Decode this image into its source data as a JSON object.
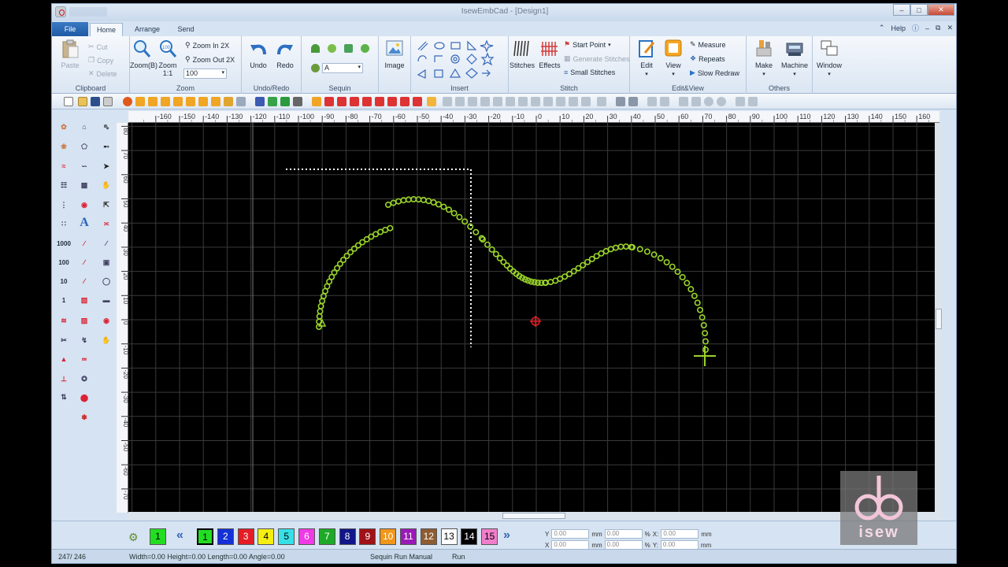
{
  "window": {
    "title": "IsewEmbCad - [Design1]"
  },
  "tabs": {
    "file": "File",
    "home": "Home",
    "arrange": "Arrange",
    "send": "Send"
  },
  "help": {
    "label": "Help"
  },
  "ribbon": {
    "clipboard": {
      "label": "Clipboard",
      "paste": "Paste",
      "cut": "Cut",
      "copy": "Copy",
      "delete": "Delete"
    },
    "zoom": {
      "label": "Zoom",
      "zoomb": "Zoom(B)",
      "zoom11": "Zoom 1:1",
      "zoom_in": "Zoom In 2X",
      "zoom_out": "Zoom Out 2X",
      "level": "100"
    },
    "undoredo": {
      "label": "Undo/Redo",
      "undo": "Undo",
      "redo": "Redo"
    },
    "sequin": {
      "label": "Sequin",
      "value": "A"
    },
    "image": {
      "label": "Image"
    },
    "insert": {
      "label": "Insert"
    },
    "stitch": {
      "label": "Stitch",
      "stitches": "Stitches",
      "effects": "Effects",
      "start_point": "Start Point",
      "generate": "Generate Stitches",
      "small": "Small Stitches"
    },
    "editview": {
      "label": "Edit&View",
      "edit": "Edit",
      "view": "View",
      "measure": "Measure",
      "repeats": "Repeats",
      "slow_redraw": "Slow Redraw"
    },
    "others": {
      "label": "Others",
      "make": "Make",
      "machine": "Machine",
      "window": "Window"
    }
  },
  "rulers": {
    "top": [
      "-160",
      "-150",
      "-140",
      "-130",
      "-120",
      "-110",
      "-100",
      "-90",
      "-80",
      "-70",
      "-60",
      "-50",
      "-40",
      "-30",
      "-20",
      "-10",
      "0",
      "10",
      "20",
      "30",
      "40",
      "50",
      "60",
      "70",
      "80",
      "90",
      "100",
      "110",
      "120",
      "130",
      "140",
      "150",
      "160"
    ],
    "left": [
      "80",
      "70",
      "60",
      "50",
      "40",
      "30",
      "20",
      "10",
      "0",
      "-10",
      "-20",
      "-30",
      "-40",
      "-50",
      "-60",
      "-70",
      "-80"
    ]
  },
  "left_tool_labels": {
    "num1000": "1000",
    "num100": "100",
    "num10": "10",
    "num1": "1",
    "text_tool": "A"
  },
  "colors": {
    "stitch": "#9ad42a",
    "swatches": [
      {
        "n": "1",
        "c": "#22dd22"
      },
      {
        "n": "2",
        "c": "#1430d6"
      },
      {
        "n": "3",
        "c": "#e51c24"
      },
      {
        "n": "4",
        "c": "#f4ee12"
      },
      {
        "n": "5",
        "c": "#36e0e6"
      },
      {
        "n": "6",
        "c": "#ef3ae6"
      },
      {
        "n": "7",
        "c": "#1eaa28"
      },
      {
        "n": "8",
        "c": "#12168a"
      },
      {
        "n": "9",
        "c": "#a01218"
      },
      {
        "n": "10",
        "c": "#f0961a"
      },
      {
        "n": "11",
        "c": "#9a1ab8"
      },
      {
        "n": "12",
        "c": "#8e5c32"
      },
      {
        "n": "13",
        "c": "#ffffff"
      },
      {
        "n": "14",
        "c": "#000000"
      },
      {
        "n": "15",
        "c": "#f27ecb"
      }
    ]
  },
  "palette": {
    "first": "1",
    "current": "1"
  },
  "coords": {
    "x_label": "X:",
    "y_label": "Y:",
    "x": "0.00",
    "y": "0.00",
    "w": "0.00",
    "h": "0.00",
    "pct1": "%",
    "pct2": "%",
    "xx": "0.00",
    "yy": "0.00",
    "mm": "mm"
  },
  "status": {
    "count": "247/ 246",
    "dims": "Width=0.00  Height=0.00  Length=0.00  Angle=0.00",
    "mode": "Sequin Run Manual",
    "run": "Run"
  },
  "logo": {
    "text": "isew"
  }
}
